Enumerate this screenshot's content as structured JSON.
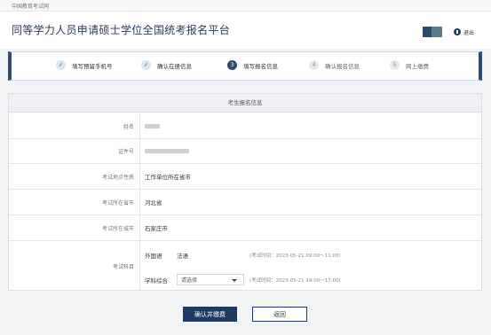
{
  "topbar": {
    "site_name": "中国教育考试网"
  },
  "header": {
    "title": "同等学力人员申请硕士学位全国统考报名平台",
    "logout_label": "退出"
  },
  "steps": [
    {
      "index": "✓",
      "label": "填写预留手机号",
      "state": "done"
    },
    {
      "index": "✓",
      "label": "确认在册信息",
      "state": "done"
    },
    {
      "index": "3",
      "label": "填写报名信息",
      "state": "active"
    },
    {
      "index": "4",
      "label": "确认报名信息",
      "state": "todo"
    },
    {
      "index": "5",
      "label": "网上缴费",
      "state": "todo"
    }
  ],
  "form": {
    "section_title": "考生报名信息",
    "name_label": "姓名",
    "id_label": "证件号",
    "location_type_label": "考试地点性质",
    "location_type_value": "工作单位所在省市",
    "province_label": "考试所在省市",
    "province_value": "河北省",
    "city_label": "考试所在城市",
    "city_value": "石家庄市",
    "subjects_label": "考试科目",
    "subject1_name": "外国语",
    "subject1_value": "法语",
    "subject1_time": "(考试时间：2023-05-21 09:00～11:00)",
    "subject2_name": "学科综合",
    "subject2_placeholder": "请选择",
    "subject2_time": "(考试时间：2023-05-21 14:00～17:00)"
  },
  "actions": {
    "confirm_label": "确认并缴费",
    "back_label": "返回"
  },
  "colors": {
    "primary": "#1f3a5f",
    "step_border": "#2e4a70"
  }
}
